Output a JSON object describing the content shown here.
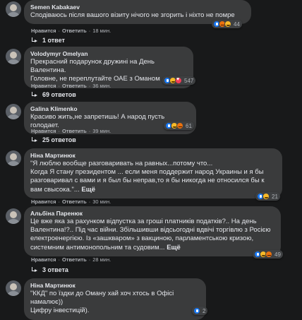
{
  "comments": [
    {
      "author": "Semen Kabakaev",
      "text": "Сподіваюсь після вашого візиту нічого не згорить і ніхто не помре",
      "action_like": "Нравится",
      "action_reply": "Ответить",
      "time": "18 мин.",
      "reactions": [
        "like",
        "angry",
        "haha"
      ],
      "reaction_count": "44",
      "replies": "1 ответ"
    },
    {
      "author": "Volodymyr Omelyan",
      "text": "Прекрасний подарунок дружині на День Валентина.\nГоловне, не переплутайте ОАЕ з Оманом",
      "action_like": "Нравится",
      "action_reply": "Ответить",
      "time": "36 мин.",
      "reactions": [
        "like",
        "haha",
        "heart"
      ],
      "reaction_count": "547",
      "replies": "69 ответов"
    },
    {
      "author": "Galina Klimenko",
      "text": "Красиво жить,не запретишь! А народ пусть голодает.",
      "action_like": "Нравится",
      "action_reply": "Ответить",
      "time": "39 мин.",
      "reactions": [
        "like",
        "haha",
        "angry"
      ],
      "reaction_count": "61",
      "replies": "25 ответов"
    },
    {
      "author": "Ніна Мартинюк",
      "text": "\"Я люблю вообще разговаривать на равных...потому что...\nКогда Я стану президентом ... если меня поддержит народ Украины и я бы разговаривал с вами и я был бы неправ,то я бы никогда не относился бы к вам свысока.\"...",
      "more": "Ещё",
      "action_like": "Нравится",
      "action_reply": "Ответить",
      "time": "30 мин.",
      "reactions": [
        "like",
        "haha"
      ],
      "reaction_count": "21",
      "replies": ""
    },
    {
      "author": "Альбіна Паренюк",
      "text": "Це вже яка за рахунком відпустка за гроші платників податків?.. На день Валентина!?.. Під час війни. Збільшивши відсьогодні вдвічі торгівлю з Росією електроенергією. Із «зашкваром» з вакциною, парламентською кризою, системним антимонопольним та судовим...",
      "more": "Ещё",
      "action_like": "Нравится",
      "action_reply": "Ответить",
      "time": "28 мин.",
      "reactions": [
        "like",
        "haha",
        "angry"
      ],
      "reaction_count": "49",
      "replies": "3 ответа"
    },
    {
      "author": "Ніна Мартинюк",
      "text": "\"ККД\" по їздки до Оману хай хоч хтось в Офісі намалює))\nЦифру інвестицій).",
      "action_like": "Нравится",
      "action_reply": "Ответить",
      "time": "",
      "reactions": [
        "like"
      ],
      "reaction_count": "2",
      "replies": ""
    }
  ]
}
